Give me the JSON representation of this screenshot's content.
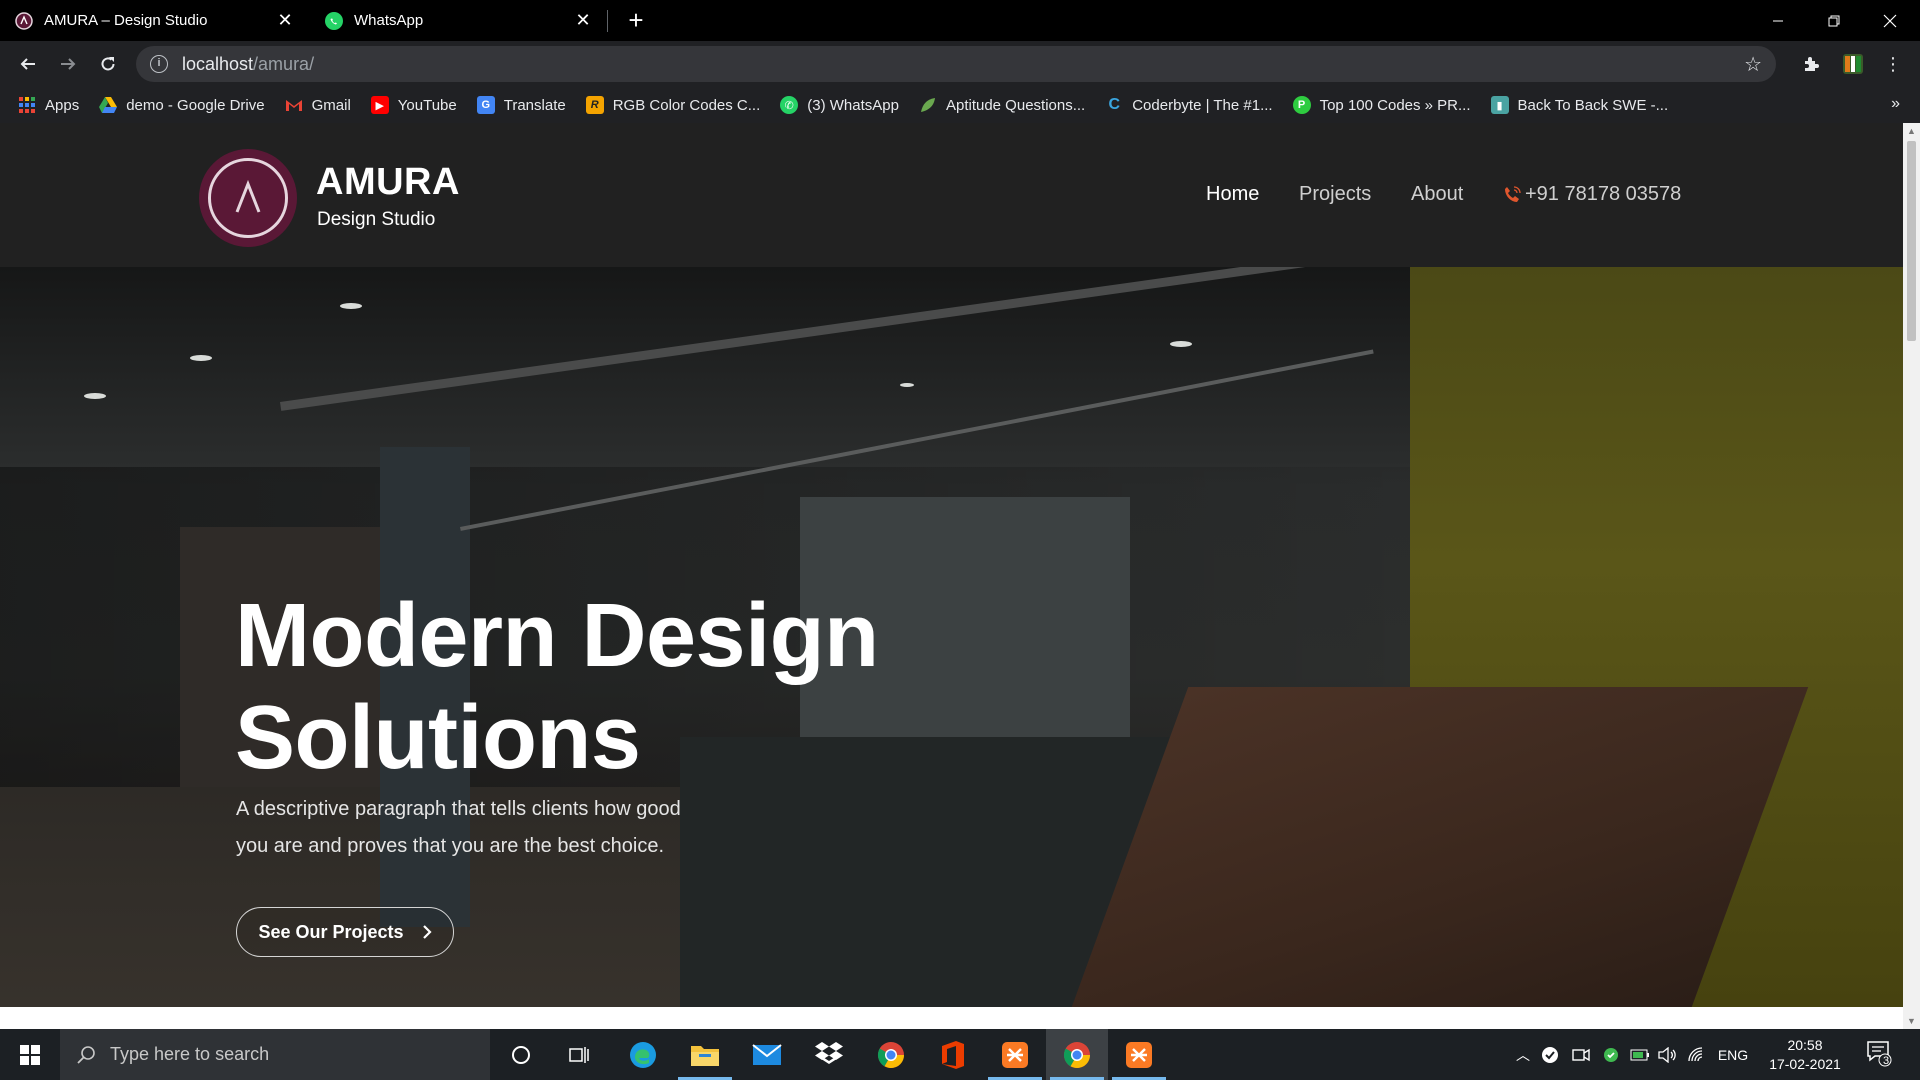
{
  "browser": {
    "tabs": [
      {
        "title": "AMURA – Design Studio",
        "active": true
      },
      {
        "title": "WhatsApp",
        "active": false
      }
    ],
    "url_host": "localhost",
    "url_path": "/amura/",
    "bookmarks": [
      {
        "label": "Apps",
        "icon": "apps-grid-icon"
      },
      {
        "label": "demo - Google Drive",
        "icon": "google-drive-icon"
      },
      {
        "label": "Gmail",
        "icon": "gmail-icon"
      },
      {
        "label": "YouTube",
        "icon": "youtube-icon"
      },
      {
        "label": "Translate",
        "icon": "translate-icon"
      },
      {
        "label": "RGB Color Codes C...",
        "icon": "rgb-icon"
      },
      {
        "label": "(3) WhatsApp",
        "icon": "whatsapp-icon"
      },
      {
        "label": "Aptitude Questions...",
        "icon": "leaf-icon"
      },
      {
        "label": "Coderbyte | The #1...",
        "icon": "coderbyte-icon"
      },
      {
        "label": "Top 100 Codes » PR...",
        "icon": "p-icon"
      },
      {
        "label": "Back To Back SWE -...",
        "icon": "book-icon"
      }
    ]
  },
  "site": {
    "brand_name": "AMURA",
    "brand_sub": "Design Studio",
    "nav": {
      "home": "Home",
      "projects": "Projects",
      "about": "About",
      "phone": "+91 78178 03578"
    },
    "hero": {
      "title_line1": "Modern Design",
      "title_line2": "Solutions",
      "desc_line1": "A descriptive paragraph that tells clients how good",
      "desc_line2": "you are and proves that you are the best choice.",
      "button": "See Our Projects"
    }
  },
  "taskbar": {
    "search_placeholder": "Type here to search",
    "language": "ENG",
    "time": "20:58",
    "date": "17-02-2021",
    "notification_count": "3"
  },
  "colors": {
    "brand_maroon": "#5a1836",
    "header_bg": "#212121",
    "phone_icon": "#e0562d"
  }
}
